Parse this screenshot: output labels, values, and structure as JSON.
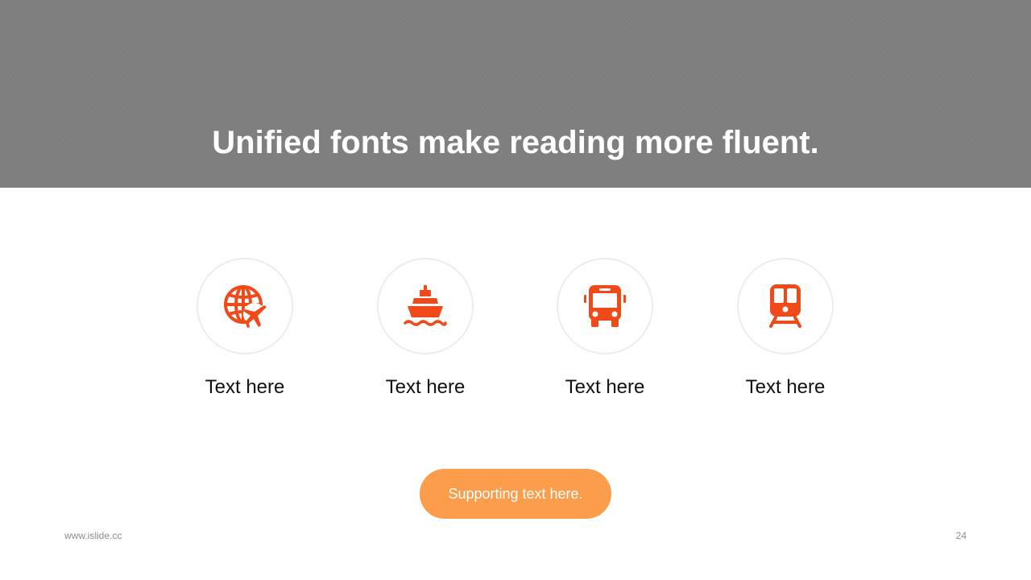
{
  "banner": {
    "title": "Unified fonts make reading more fluent."
  },
  "items": [
    {
      "label": "Text here",
      "icon": "globe-plane-icon"
    },
    {
      "label": "Text here",
      "icon": "ship-icon"
    },
    {
      "label": "Text here",
      "icon": "bus-icon"
    },
    {
      "label": "Text here",
      "icon": "train-icon"
    }
  ],
  "supporting": {
    "label": "Supporting text here."
  },
  "footer": {
    "website": "www.islide.cc",
    "page_number": "24"
  },
  "colors": {
    "banner_bg": "#7f7f7f",
    "icon_accent": "#f04a1a",
    "pill_bg": "#fb9d4a",
    "circle_border": "#ececec"
  }
}
